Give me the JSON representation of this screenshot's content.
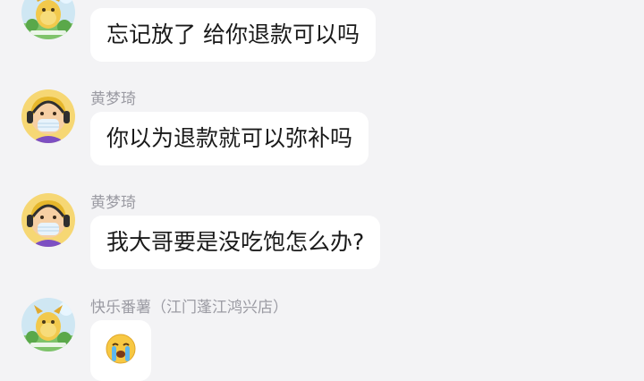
{
  "messages": [
    {
      "sender": "快乐番薯（江门蓬江鸿兴店）",
      "avatar": "shop-mascot-avatar",
      "text": "忘记放了 给你退款可以吗"
    },
    {
      "sender": "黄梦琦",
      "avatar": "masked-person-avatar",
      "text": "你以为退款就可以弥补吗"
    },
    {
      "sender": "黄梦琦",
      "avatar": "masked-person-avatar",
      "text": "我大哥要是没吃饱怎么办?"
    },
    {
      "sender": "快乐番薯（江门蓬江鸿兴店）",
      "avatar": "shop-mascot-avatar",
      "emoji": "crying-face-emoji"
    }
  ],
  "colors": {
    "background": "#f3f3f5",
    "bubble": "#ffffff",
    "sender_text": "#9b9ba3",
    "message_text": "#1a1a1a"
  }
}
